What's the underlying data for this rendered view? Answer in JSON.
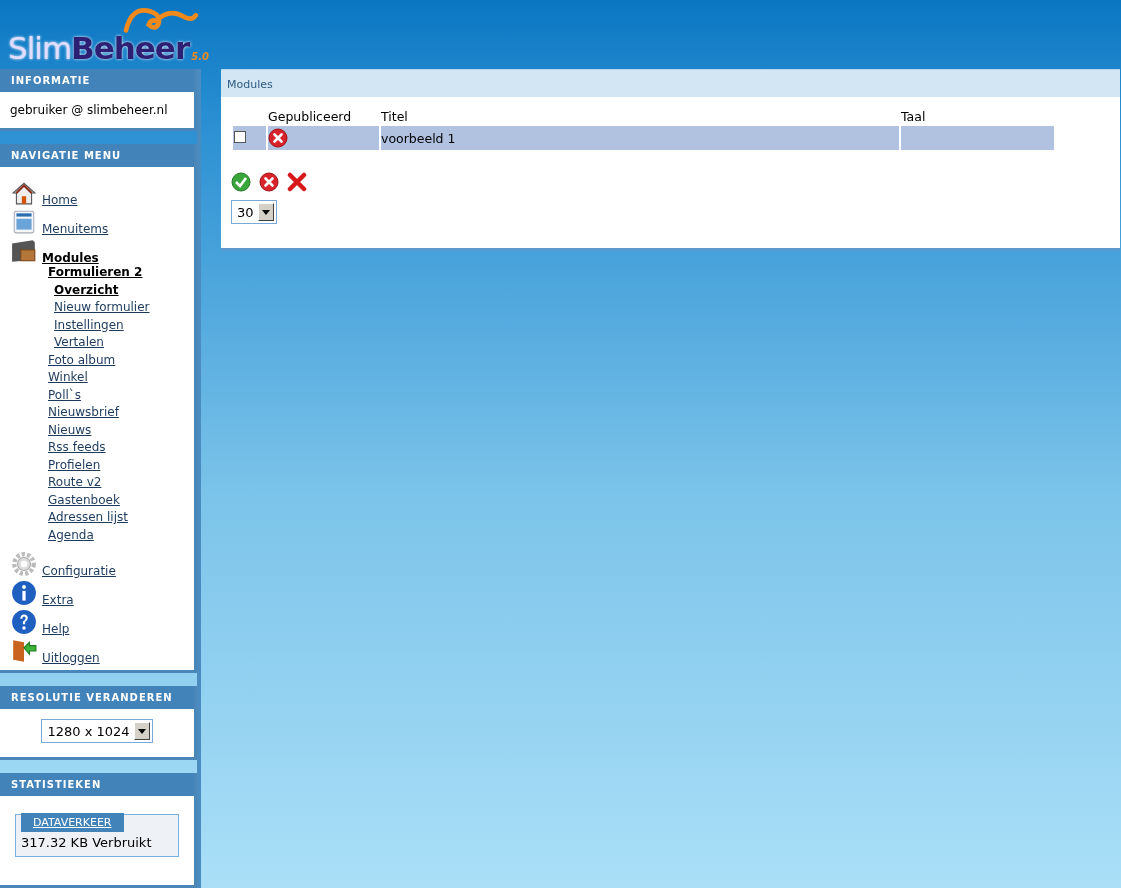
{
  "logo": {
    "name": "Slim**Beheer**",
    "version": "5.0"
  },
  "sidebar": {
    "info": {
      "title": "INFORMATIE",
      "user": "gebruiker @ slimbeheer.nl"
    },
    "nav": {
      "title": "NAVIGATIE MENU",
      "items": [
        {
          "label": "Home",
          "kind": "home",
          "selected": false
        },
        {
          "label": "Menuitems",
          "kind": "page",
          "selected": false
        },
        {
          "label": "Modules",
          "kind": "box",
          "selected": true,
          "children": [
            {
              "label": "Formulieren 2",
              "selected": true,
              "children": [
                {
                  "label": "Overzicht",
                  "selected": true
                },
                {
                  "label": "Nieuw formulier",
                  "selected": false
                },
                {
                  "label": "Instellingen",
                  "selected": false
                },
                {
                  "label": "Vertalen",
                  "selected": false
                }
              ]
            },
            {
              "label": "Foto album",
              "selected": false
            },
            {
              "label": "Winkel",
              "selected": false
            },
            {
              "label": "Poll`s",
              "selected": false
            },
            {
              "label": "Nieuwsbrief",
              "selected": false
            },
            {
              "label": "Nieuws",
              "selected": false
            },
            {
              "label": "Rss feeds",
              "selected": false
            },
            {
              "label": "Profielen",
              "selected": false
            },
            {
              "label": "Route v2",
              "selected": false
            },
            {
              "label": "Gastenboek",
              "selected": false
            },
            {
              "label": "Adressen lijst",
              "selected": false
            },
            {
              "label": "Agenda",
              "selected": false
            }
          ]
        },
        {
          "label": "Configuratie",
          "kind": "gear",
          "selected": false
        },
        {
          "label": "Extra",
          "kind": "info",
          "selected": false
        },
        {
          "label": "Help",
          "kind": "help",
          "selected": false
        },
        {
          "label": "Uitloggen",
          "kind": "logout",
          "selected": false
        }
      ]
    },
    "resolution": {
      "title": "RESOLUTIE VERANDEREN",
      "value": "1280 x 1024"
    },
    "stats": {
      "title": "STATISTIEKEN",
      "legend": "DATAVERKEER",
      "usage": "317.32 KB Verbruikt"
    }
  },
  "main": {
    "title": "Modules",
    "columns": [
      "Gepubliceerd",
      "Titel",
      "Taal"
    ],
    "rows": [
      {
        "checked": false,
        "published": false,
        "title": "voorbeeld 1"
      }
    ],
    "actions": [
      {
        "kind": "publish"
      },
      {
        "kind": "unpublish"
      },
      {
        "kind": "delete"
      }
    ],
    "page_size": "30"
  }
}
